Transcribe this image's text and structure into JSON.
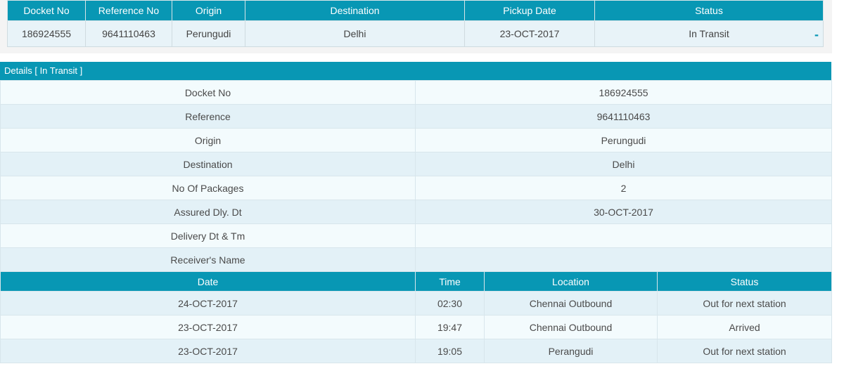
{
  "summary": {
    "headers": [
      "Docket No",
      "Reference No",
      "Origin",
      "Destination",
      "Pickup Date",
      "Status"
    ],
    "row": {
      "docket_no": "186924555",
      "reference_no": "9641110463",
      "origin": "Perungudi",
      "destination": "Delhi",
      "pickup_date": "23-OCT-2017",
      "status": "In Transit",
      "toggle": "-"
    }
  },
  "details": {
    "header": "Details [ In Transit ]",
    "fields": [
      {
        "label": "Docket No",
        "value": "186924555"
      },
      {
        "label": "Reference",
        "value": "9641110463"
      },
      {
        "label": "Origin",
        "value": "Perungudi"
      },
      {
        "label": "Destination",
        "value": "Delhi"
      },
      {
        "label": "No Of Packages",
        "value": "2"
      },
      {
        "label": "Assured Dly. Dt",
        "value": "30-OCT-2017"
      },
      {
        "label": "Delivery Dt & Tm",
        "value": ""
      },
      {
        "label": "Receiver's Name",
        "value": ""
      }
    ]
  },
  "tracking": {
    "headers": [
      "Date",
      "Time",
      "Location",
      "Status"
    ],
    "rows": [
      {
        "date": "24-OCT-2017",
        "time": "02:30",
        "location": "Chennai Outbound",
        "status": "Out for next station"
      },
      {
        "date": "23-OCT-2017",
        "time": "19:47",
        "location": "Chennai Outbound",
        "status": "Arrived"
      },
      {
        "date": "23-OCT-2017",
        "time": "19:05",
        "location": "Perangudi",
        "status": "Out for next station"
      }
    ]
  },
  "colors": {
    "header_teal": "#0897b4",
    "row_light": "#f3fbfd",
    "row_alt": "#e3f1f7"
  }
}
